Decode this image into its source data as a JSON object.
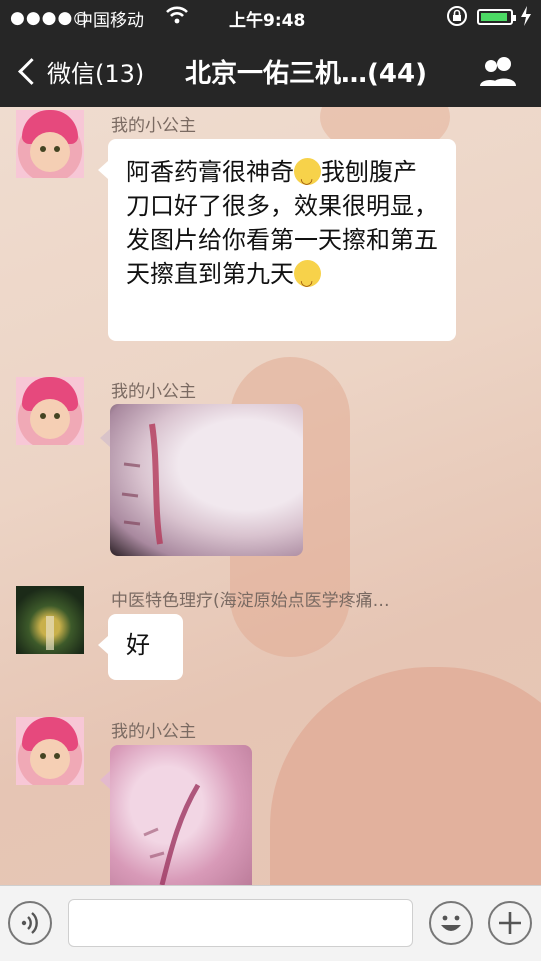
{
  "status_bar": {
    "signal": "●●●●○",
    "carrier": "中国移动",
    "time": "上午9:48"
  },
  "nav": {
    "back_label": "微信(13)",
    "title": "北京一佑三机…(44)"
  },
  "messages": [
    {
      "sender": "我的小公主",
      "text_parts": [
        "阿香药膏很神奇",
        "我刨腹产刀口好了很多，效果很明显，发图片给你看第一天擦和第五天擦直到第九天"
      ]
    },
    {
      "sender": "我的小公主"
    },
    {
      "sender": "中医特色理疗(海淀原始点医学疼痛…",
      "text": "好"
    },
    {
      "sender": "我的小公主"
    }
  ],
  "input": {
    "placeholder": ""
  },
  "colors": {
    "topbar": "#262626",
    "battery": "#4cd964",
    "bubble": "#ffffff"
  },
  "icons": [
    "back-chevron-icon",
    "wifi-icon",
    "lock-rotation-icon",
    "battery-icon",
    "group-members-icon",
    "voice-icon",
    "emoji-icon",
    "plus-icon"
  ]
}
